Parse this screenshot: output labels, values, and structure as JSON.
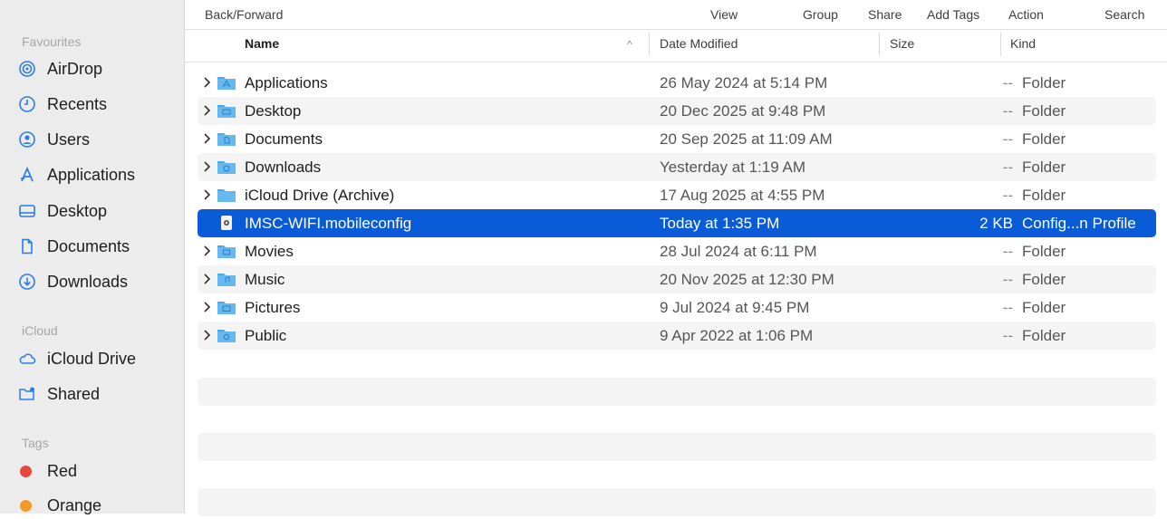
{
  "toolbar": {
    "back_forward": "Back/Forward",
    "view": "View",
    "group": "Group",
    "share": "Share",
    "add_tags": "Add Tags",
    "action": "Action",
    "search": "Search"
  },
  "columns": {
    "name": "Name",
    "date": "Date Modified",
    "size": "Size",
    "kind": "Kind",
    "sort_glyph": "^"
  },
  "sidebar": {
    "favourites_label": "Favourites",
    "favourites": [
      {
        "label": "AirDrop",
        "icon": "airdrop-icon"
      },
      {
        "label": "Recents",
        "icon": "clock-icon"
      },
      {
        "label": "Users",
        "icon": "user-icon"
      },
      {
        "label": "Applications",
        "icon": "applications-icon"
      },
      {
        "label": "Desktop",
        "icon": "desktop-icon"
      },
      {
        "label": "Documents",
        "icon": "document-icon"
      },
      {
        "label": "Downloads",
        "icon": "download-icon"
      }
    ],
    "icloud_label": "iCloud",
    "icloud": [
      {
        "label": "iCloud Drive",
        "icon": "cloud-icon"
      },
      {
        "label": "Shared",
        "icon": "shared-folder-icon"
      }
    ],
    "tags_label": "Tags",
    "tags": [
      {
        "label": "Red",
        "color": "#e5483f"
      },
      {
        "label": "Orange",
        "color": "#f19a2a"
      }
    ]
  },
  "files": [
    {
      "name": "Applications",
      "date": "26 May 2024 at 5:14 PM",
      "size": "--",
      "kind": "Folder"
    },
    {
      "name": "Desktop",
      "date": "20 Dec 2025 at 9:48 PM",
      "size": "--",
      "kind": "Folder"
    },
    {
      "name": "Documents",
      "date": "20 Sep 2025 at 11:09 AM",
      "size": "--",
      "kind": "Folder"
    },
    {
      "name": "Downloads",
      "date": "Yesterday at 1:19 AM",
      "size": "--",
      "kind": "Folder"
    },
    {
      "name": "iCloud Drive (Archive)",
      "date": "17 Aug 2025 at 4:55 PM",
      "size": "--",
      "kind": "Folder"
    },
    {
      "name": "IMSC-WIFI.mobileconfig",
      "date": "Today at 1:35 PM",
      "size": "2 KB",
      "kind": "Config...n Profile"
    },
    {
      "name": "Movies",
      "date": "28 Jul 2024 at 6:11 PM",
      "size": "--",
      "kind": "Folder"
    },
    {
      "name": "Music",
      "date": "20 Nov 2025 at 12:30 PM",
      "size": "--",
      "kind": "Folder"
    },
    {
      "name": "Pictures",
      "date": "9 Jul 2024 at 9:45 PM",
      "size": "--",
      "kind": "Folder"
    },
    {
      "name": "Public",
      "date": "9 Apr 2022 at 1:06 PM",
      "size": "--",
      "kind": "Folder"
    }
  ],
  "colors": {
    "selection": "#0a5bd8",
    "folder": "#4aa8e6",
    "sidebar_icon": "#2b7de9"
  }
}
